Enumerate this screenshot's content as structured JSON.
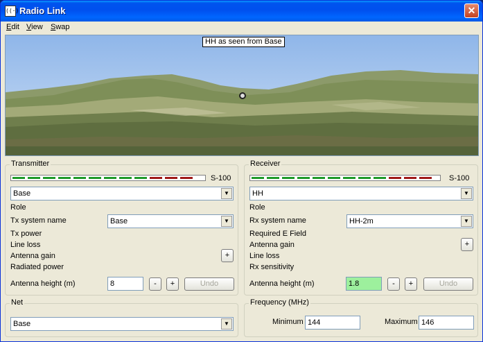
{
  "window": {
    "title": "Radio Link",
    "app_icon": "radio-icon",
    "close_label": "✕"
  },
  "menu": [
    {
      "label": "Edit"
    },
    {
      "label": "View"
    },
    {
      "label": "Swap"
    }
  ],
  "view": {
    "caption": "HH as seen from Base"
  },
  "transmitter": {
    "legend": "Transmitter",
    "meter_label": "S-100",
    "meter_segments": {
      "green": 9,
      "red": 3
    },
    "selected": "Base",
    "role_label": "Role",
    "system_label": "Tx system name",
    "system_value": "Base",
    "tx_power_label": "Tx power",
    "line_loss_label": "Line loss",
    "antenna_gain_label": "Antenna gain",
    "radiated_power_label": "Radiated power",
    "plus_label": "+",
    "antenna_height_label": "Antenna height (m)",
    "antenna_height_value": "8",
    "minus_btn": "-",
    "plus_btn": "+",
    "undo_label": "Undo"
  },
  "receiver": {
    "legend": "Receiver",
    "meter_label": "S-100",
    "meter_segments": {
      "green": 9,
      "red": 3
    },
    "selected": "HH",
    "role_label": "Role",
    "system_label": "Rx system name",
    "system_value": "HH-2m",
    "required_field_label": "Required E Field",
    "antenna_gain_label": "Antenna gain",
    "line_loss_label": "Line loss",
    "rx_sensitivity_label": "Rx sensitivity",
    "plus_label": "+",
    "antenna_height_label": "Antenna height (m)",
    "antenna_height_value": "1.8",
    "minus_btn": "-",
    "plus_btn": "+",
    "undo_label": "Undo"
  },
  "net": {
    "legend": "Net",
    "selected": "Base"
  },
  "frequency": {
    "legend": "Frequency (MHz)",
    "min_label": "Minimum",
    "min_value": "144",
    "max_label": "Maximum",
    "max_value": "146"
  },
  "colors": {
    "meter_green": "#1f9a2a",
    "meter_red": "#a01818",
    "highlight_input": "#9df09d"
  }
}
